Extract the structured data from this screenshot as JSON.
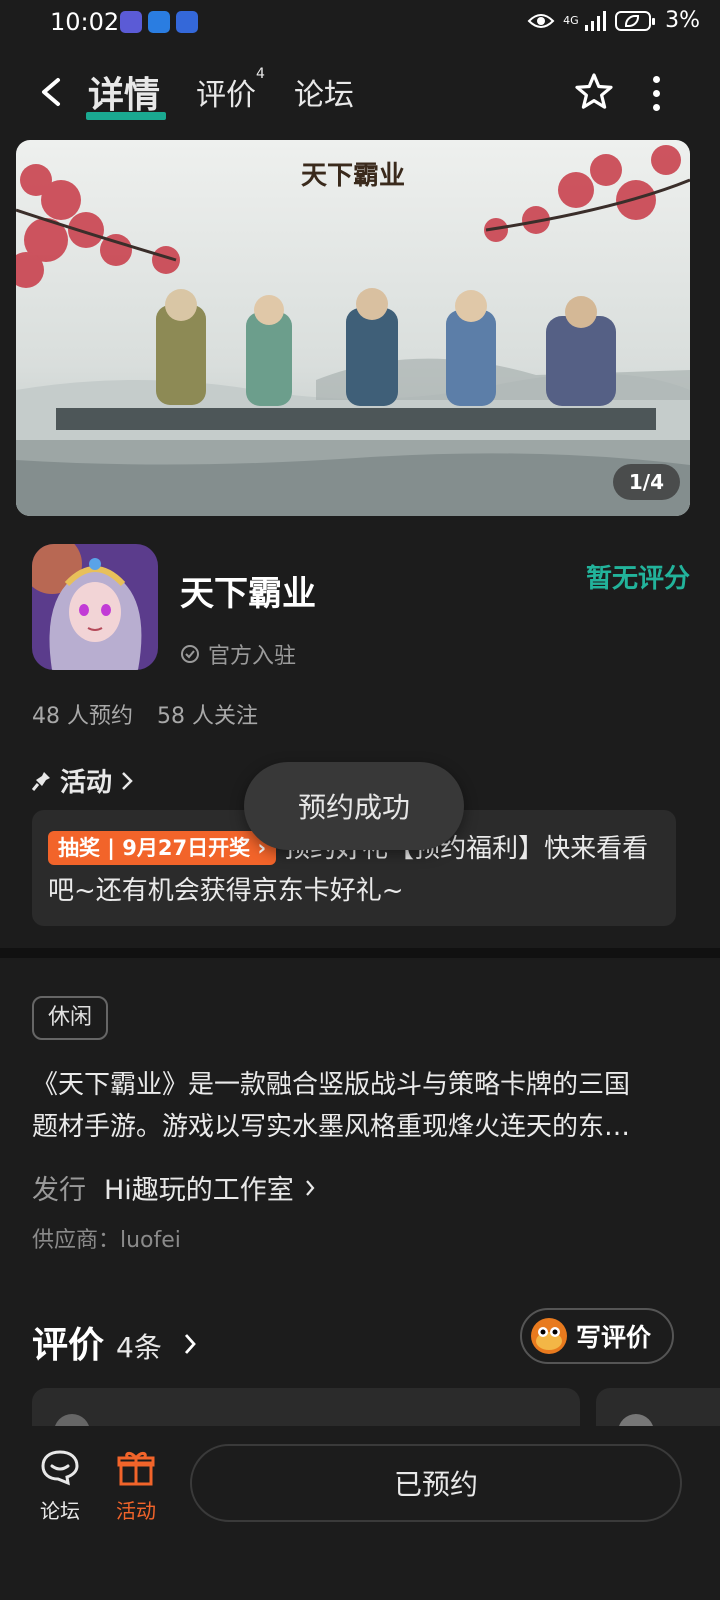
{
  "status_bar": {
    "time": "10:02",
    "network": "4G",
    "battery": "3%"
  },
  "nav": {
    "tabs": [
      {
        "label": "详情",
        "active": true
      },
      {
        "label": "评价",
        "badge": "4"
      },
      {
        "label": "论坛"
      }
    ]
  },
  "banner": {
    "logo_text": "天下霸业",
    "counter": "1/4"
  },
  "app": {
    "name": "天下霸业",
    "official_label": "官方入驻",
    "rating_text": "暂无评分",
    "reservations": "48 人预约",
    "followers": "58 人关注"
  },
  "activity": {
    "header": "活动",
    "tag": "抽奖 | 9月27日开奖 ›",
    "text": "预约好礼【预约福利】快来看看吧~还有机会获得京东卡好礼~"
  },
  "toast": "预约成功",
  "details": {
    "genre": "休闲",
    "description_line1": "《天下霸业》是一款融合竖版战斗与策略卡牌的三国",
    "description_line2": "题材手游。游戏以写实水墨风格重现烽火连天的东…",
    "publisher_label": "发行",
    "publisher_name": "Hi趣玩的工作室",
    "supplier": "供应商：luofei"
  },
  "reviews": {
    "title": "评价",
    "count": "4条",
    "write_label": "写评价"
  },
  "bottom_bar": {
    "forum_label": "论坛",
    "activity_label": "活动",
    "reserve_label": "已预约"
  },
  "colors": {
    "accent_teal": "#1aa991",
    "rating_green": "#22b39b",
    "activity_orange": "#f2642a",
    "background": "#1c1c1c"
  }
}
